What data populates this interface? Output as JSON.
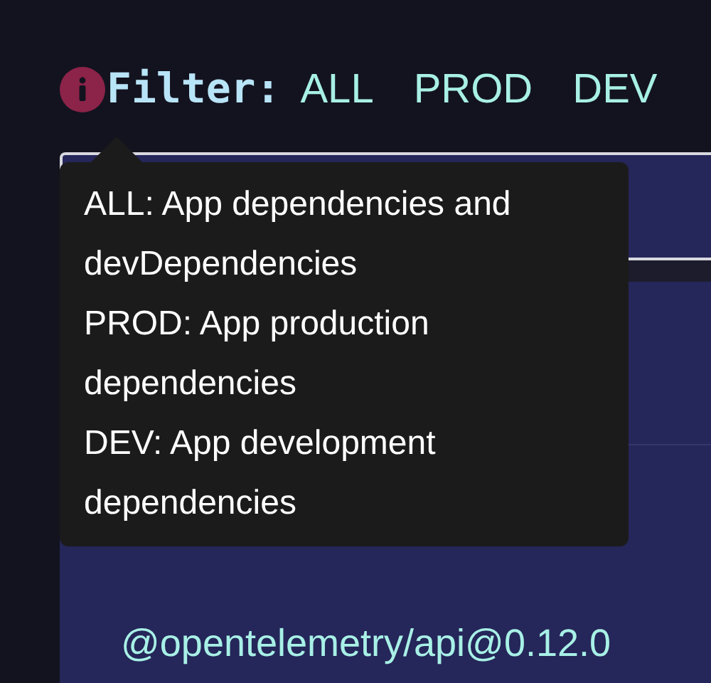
{
  "filter": {
    "label": "Filter:",
    "options": [
      {
        "label": "ALL"
      },
      {
        "label": "PROD"
      },
      {
        "label": "DEV"
      }
    ]
  },
  "tooltip": {
    "lines": [
      "ALL: App dependencies and devDependencies",
      "PROD: App production dependencies",
      "DEV: App development dependencies"
    ]
  },
  "packages": [
    {
      "name": "@opentelemetry/api@0.12.0"
    }
  ]
}
